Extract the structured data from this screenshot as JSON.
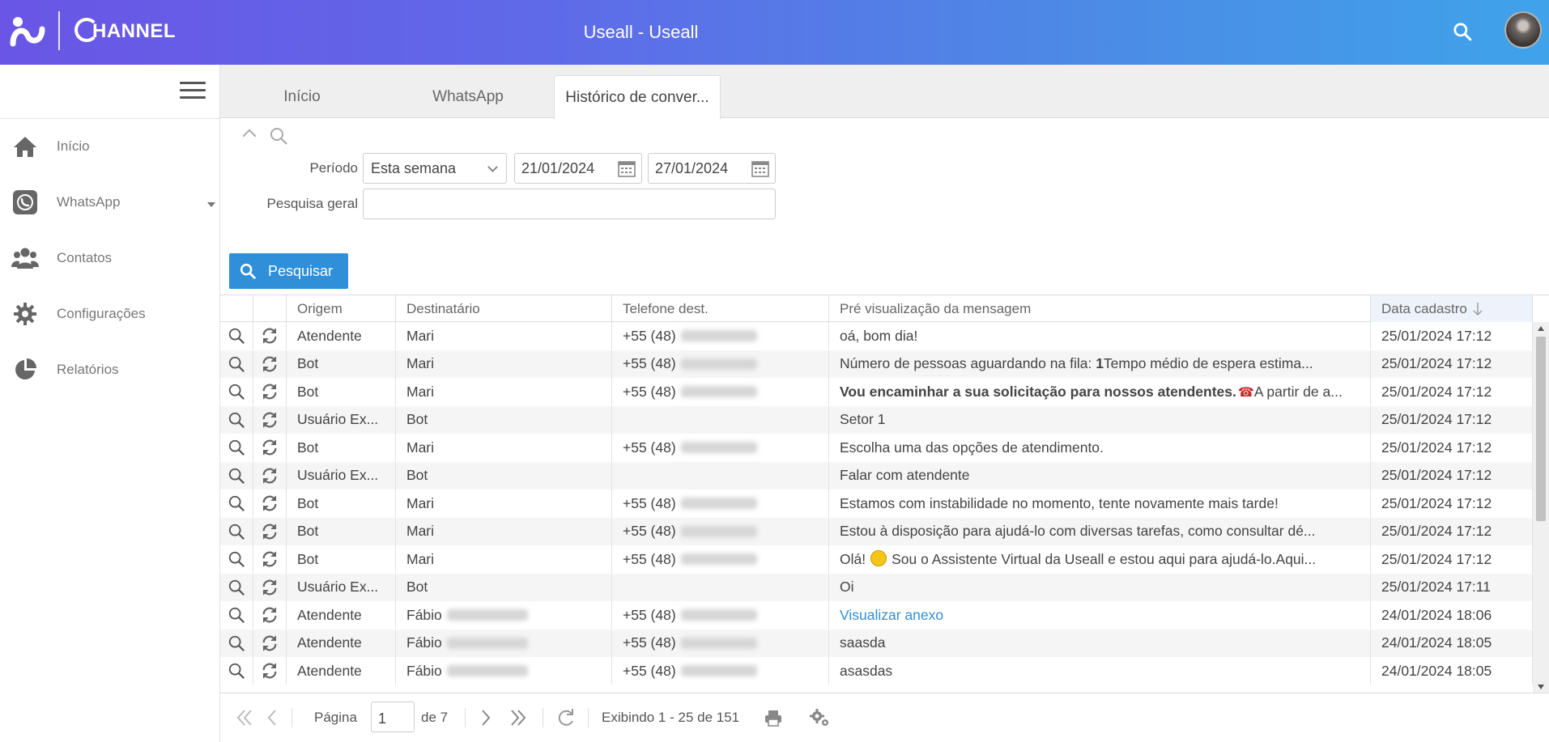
{
  "header": {
    "logo_text": "HANNEL",
    "title": "Useall - Useall"
  },
  "sidebar": {
    "items": [
      {
        "label": "Início",
        "icon": "home-icon"
      },
      {
        "label": "WhatsApp",
        "icon": "whatsapp-icon"
      },
      {
        "label": "Contatos",
        "icon": "contacts-icon"
      },
      {
        "label": "Configurações",
        "icon": "gear-icon"
      },
      {
        "label": "Relatórios",
        "icon": "pie-chart-icon"
      }
    ]
  },
  "tabs": [
    {
      "label": "Início",
      "active": false
    },
    {
      "label": "WhatsApp",
      "active": false
    },
    {
      "label": "Histórico de conver...",
      "active": true
    }
  ],
  "filter": {
    "period_label": "Período",
    "period_value": "Esta semana",
    "date_from": "21/01/2024",
    "date_to": "27/01/2024",
    "general_search_label": "Pesquisa geral",
    "general_search_value": "",
    "search_button": "Pesquisar"
  },
  "grid": {
    "columns": [
      "Origem",
      "Destinatário",
      "Telefone dest.",
      "Pré visualização da mensagem",
      "Data cadastro"
    ],
    "sorted_column": "Data cadastro",
    "sort_direction": "desc",
    "rows": [
      {
        "origem": "Atendente",
        "dest": "Mari",
        "phone": "+55 (48)",
        "msg": "oá, bom dia!",
        "date": "25/01/2024 17:12"
      },
      {
        "origem": "Bot",
        "dest": "Mari",
        "phone": "+55 (48)",
        "msg_pre": "Número de pessoas aguardando na fila: ",
        "msg_bold": "1",
        "msg_post": "Tempo médio de espera estima...",
        "date": "25/01/2024 17:12"
      },
      {
        "origem": "Bot",
        "dest": "Mari",
        "phone": "+55 (48)",
        "msg_bold": "Vou encaminhar a sua solicitação para nossos atendentes.",
        "msg_post": "A partir de a...",
        "emoji": "phone",
        "date": "25/01/2024 17:12"
      },
      {
        "origem": "Usuário Ex...",
        "dest": "Bot",
        "phone": "",
        "msg": "Setor 1",
        "date": "25/01/2024 17:12"
      },
      {
        "origem": "Bot",
        "dest": "Mari",
        "phone": "+55 (48)",
        "msg": "Escolha uma das opções de atendimento.",
        "date": "25/01/2024 17:12"
      },
      {
        "origem": "Usuário Ex...",
        "dest": "Bot",
        "phone": "",
        "msg": "Falar com atendente",
        "date": "25/01/2024 17:12"
      },
      {
        "origem": "Bot",
        "dest": "Mari",
        "phone": "+55 (48)",
        "msg": "Estamos com instabilidade no momento, tente novamente mais tarde!",
        "date": "25/01/2024 17:12"
      },
      {
        "origem": "Bot",
        "dest": "Mari",
        "phone": "+55 (48)",
        "msg": "Estou à disposição para ajudá-lo com diversas tarefas, como consultar dé...",
        "date": "25/01/2024 17:12"
      },
      {
        "origem": "Bot",
        "dest": "Mari",
        "phone": "+55 (48)",
        "msg_pre": "Olá!",
        "msg_post": "Sou o Assistente Virtual da Useall e estou aqui para ajudá-lo.Aqui...",
        "emoji": "smile",
        "date": "25/01/2024 17:12"
      },
      {
        "origem": "Usuário Ex...",
        "dest": "Bot",
        "phone": "",
        "msg": "Oi",
        "date": "25/01/2024 17:11"
      },
      {
        "origem": "Atendente",
        "dest": "Fábio",
        "phone": "+55 (48)",
        "msg": "Visualizar anexo",
        "link": true,
        "date": "24/01/2024 18:06"
      },
      {
        "origem": "Atendente",
        "dest": "Fábio",
        "phone": "+55 (48)",
        "msg": "saasda",
        "date": "24/01/2024 18:05"
      },
      {
        "origem": "Atendente",
        "dest": "Fábio",
        "phone": "+55 (48)",
        "msg": "asasdas",
        "date": "24/01/2024 18:05"
      }
    ]
  },
  "pager": {
    "page_label": "Página",
    "page_value": "1",
    "of_label": "de 7",
    "summary": "Exibindo 1 - 25 de 151"
  }
}
